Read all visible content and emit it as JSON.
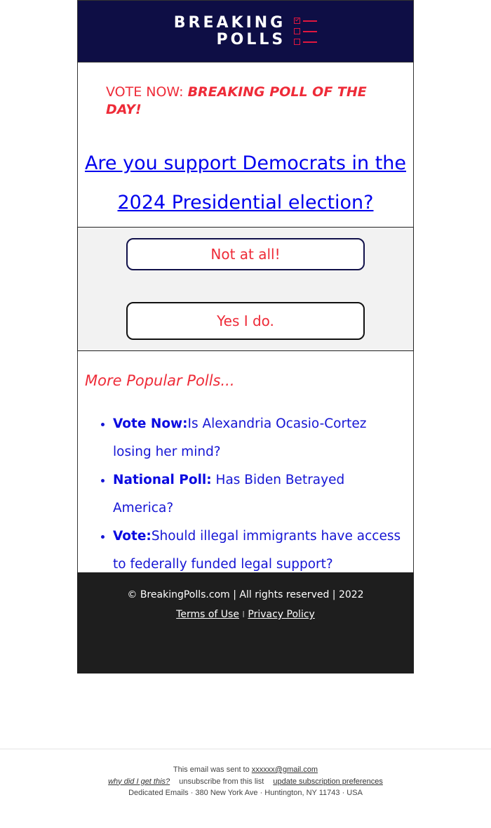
{
  "header": {
    "logo_line1": "BREAKING",
    "logo_line2": "POLLS",
    "logo_icon": "checklist-icon",
    "brand_colors": {
      "navy": "#0e0e45",
      "red": "#e0173f"
    }
  },
  "banner": {
    "prefix": "VOTE NOW: ",
    "emphasis": "BREAKING POLL OF THE DAY!"
  },
  "question": {
    "text": "Are you support Democrats in the 2024 Presidential election?"
  },
  "answers": [
    {
      "label": "Not at all!"
    },
    {
      "label": "Yes I do."
    }
  ],
  "more_polls": {
    "heading": "More Popular Polls...",
    "items": [
      {
        "prefix": "Vote Now:",
        "text": "Is Alexandria Ocasio-Cortez losing her mind?"
      },
      {
        "prefix": "National Poll:",
        "text": " Has Biden Betrayed America?"
      },
      {
        "prefix": "Vote:",
        "text": "Should illegal immigrants have access to federally funded legal support?"
      }
    ]
  },
  "footer": {
    "copyright": "© BreakingPolls.com | All rights reserved | 2022",
    "terms": "Terms of Use",
    "separator": "I",
    "privacy": "Privacy Policy"
  },
  "meta": {
    "sent_to_prefix": "This email was sent to ",
    "email": "xxxxxx@gmail.com",
    "why": "why did I get this?",
    "unsubscribe": "unsubscribe from this list",
    "preferences": "update subscription preferences",
    "address": "Dedicated Emails · 380 New York Ave · Huntington, NY 11743 · USA"
  }
}
